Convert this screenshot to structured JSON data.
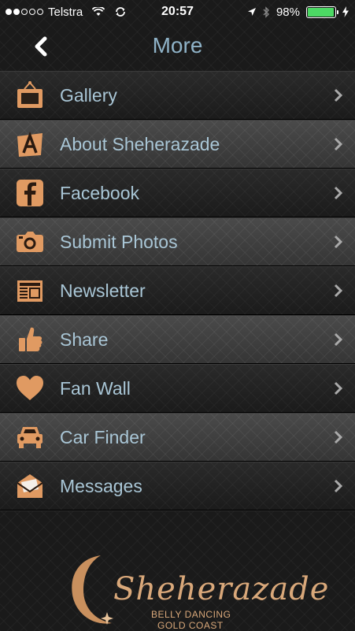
{
  "status_bar": {
    "carrier": "Telstra",
    "time": "20:57",
    "battery": "98%",
    "battery_level": 0.98,
    "signal_bars_filled": 2,
    "signal_bars_total": 5
  },
  "navbar": {
    "title": "More",
    "back_icon": "chevron-left-icon"
  },
  "colors": {
    "accent": "#e09a62",
    "label": "#a9c6d6",
    "title": "#8fb3c8"
  },
  "menu": {
    "items": [
      {
        "label": "Gallery",
        "icon": "picture-frame-icon"
      },
      {
        "label": "About Sheherazade",
        "icon": "letter-a-icon"
      },
      {
        "label": "Facebook",
        "icon": "facebook-icon"
      },
      {
        "label": "Submit Photos",
        "icon": "camera-icon"
      },
      {
        "label": "Newsletter",
        "icon": "newspaper-icon"
      },
      {
        "label": "Share",
        "icon": "thumbs-up-icon"
      },
      {
        "label": "Fan Wall",
        "icon": "heart-icon"
      },
      {
        "label": "Car Finder",
        "icon": "car-icon"
      },
      {
        "label": "Messages",
        "icon": "envelope-icon"
      }
    ]
  },
  "footer": {
    "logo_name": "Sheherazade",
    "logo_line1": "BELLY DANCING",
    "logo_line2": "GOLD COAST"
  }
}
